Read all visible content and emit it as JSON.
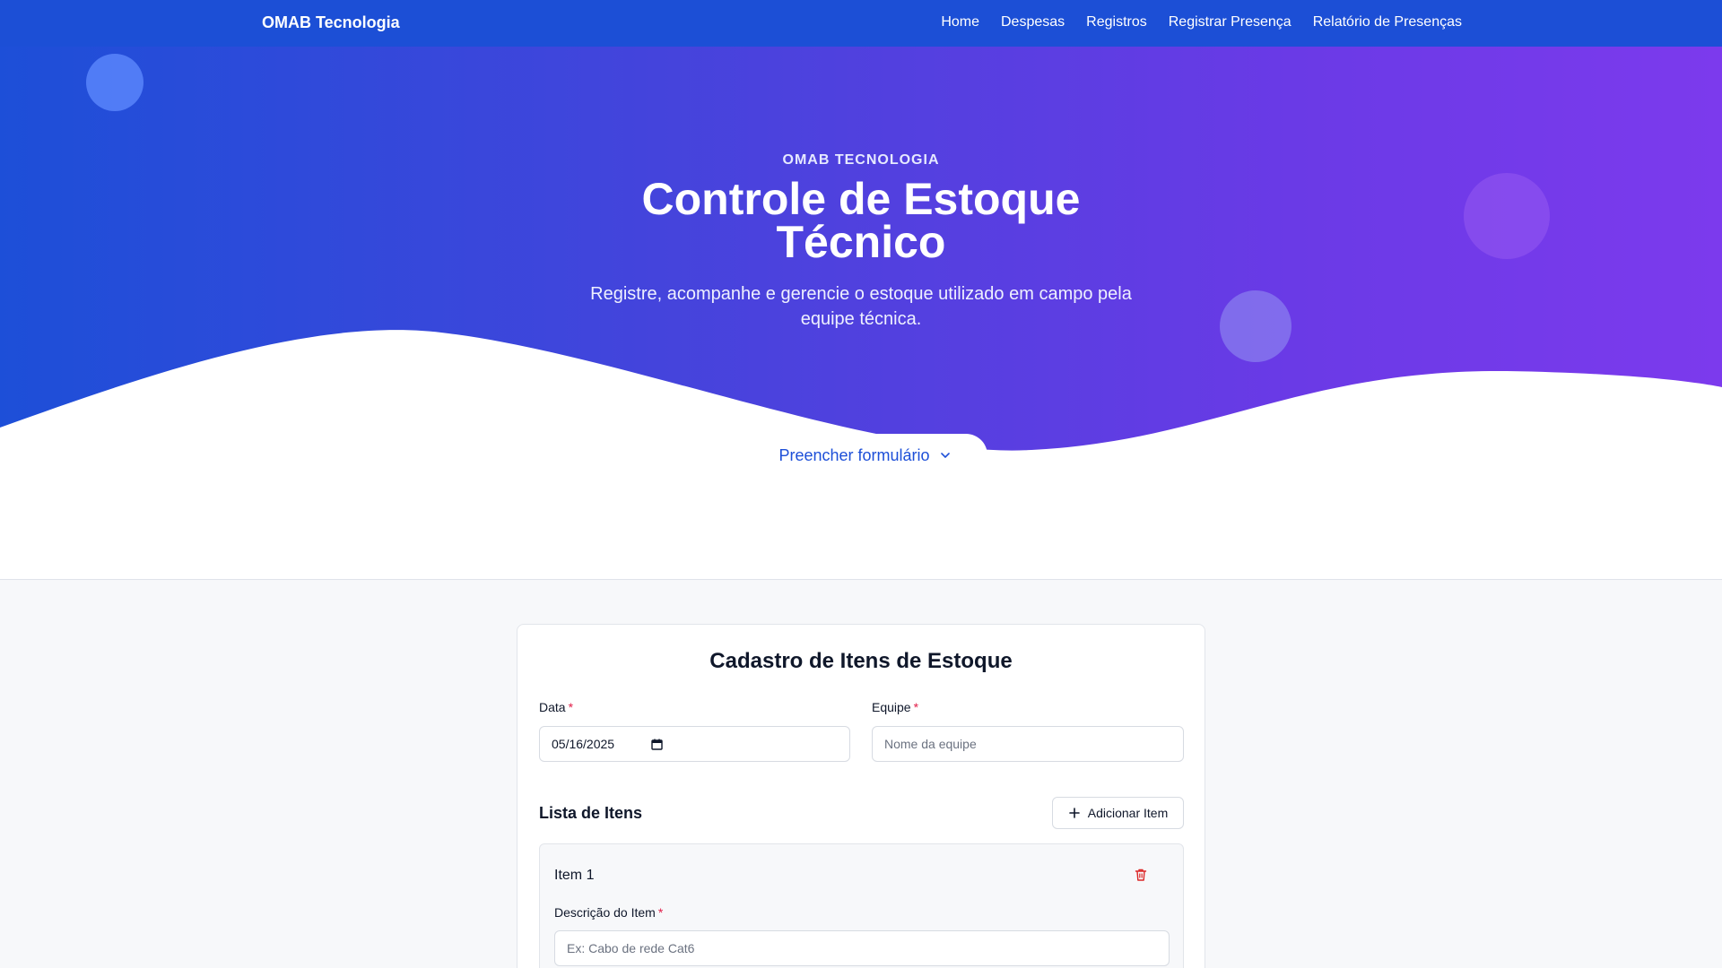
{
  "navbar": {
    "brand": "OMAB Tecnologia",
    "links": [
      "Home",
      "Despesas",
      "Registros",
      "Registrar Presença",
      "Relatório de Presenças"
    ]
  },
  "hero": {
    "eyebrow": "OMAB TECNOLOGIA",
    "title": "Controle de Estoque Técnico",
    "subtitle": "Registre, acompanhe e gerencie o estoque utilizado em campo pela equipe técnica.",
    "cta_label": "Preencher formulário",
    "cta_icon": "chevron-down-icon"
  },
  "form": {
    "title": "Cadastro de Itens de Estoque",
    "date": {
      "label": "Data",
      "required_mark": "*",
      "value": "05/16/2025",
      "icon": "calendar-icon"
    },
    "team": {
      "label": "Equipe",
      "required_mark": "*",
      "placeholder": "Nome da equipe"
    },
    "items_section": {
      "title": "Lista de Itens",
      "add_label": "Adicionar Item",
      "add_icon": "plus-icon"
    },
    "items": [
      {
        "title": "Item 1",
        "delete_icon": "trash-icon",
        "description": {
          "label": "Descrição do Item",
          "required_mark": "*",
          "placeholder": "Ex: Cabo de rede Cat6"
        }
      }
    ]
  },
  "colors": {
    "navbar": "#1c4fd6",
    "gradient_start": "#1d4fd8",
    "gradient_end": "#7c3aed",
    "required": "#e11d48",
    "delete": "#dc2626"
  }
}
